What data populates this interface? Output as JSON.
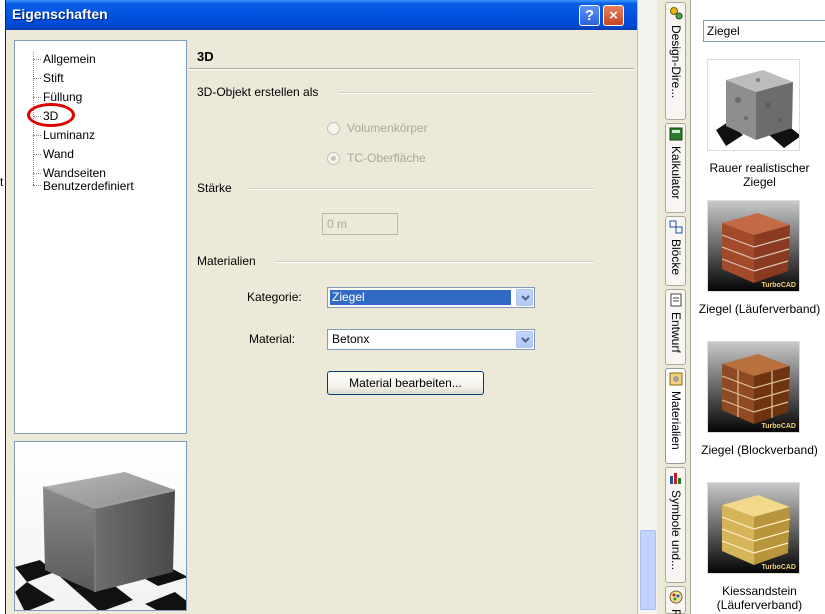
{
  "stray_text": "t",
  "dialog": {
    "title": "Eigenschaften",
    "help_label": "?",
    "close_label": "×"
  },
  "tree": {
    "items": [
      "Allgemein",
      "Stift",
      "Füllung",
      "3D",
      "Luminanz",
      "Wand",
      "Wandseiten",
      "Benutzerdefiniert"
    ],
    "selected": "3D"
  },
  "pane": {
    "title": "3D",
    "group_create": "3D-Objekt erstellen als",
    "radio_solid": "Volumenkörper",
    "radio_surface": "TC-Oberfläche",
    "group_thickness": "Stärke",
    "thickness_value": "0 m",
    "group_materials": "Materialien",
    "category_label": "Kategorie:",
    "category_value": "Ziegel",
    "material_label": "Material:",
    "material_value": "Betonx",
    "edit_button": "Material bearbeiten..."
  },
  "sidebar": {
    "search_value": "Ziegel",
    "tabs": [
      "Design-Dire...",
      "Kalkulator",
      "Blöcke",
      "Entwurf",
      "Materialien",
      "Symbole und...",
      "F"
    ],
    "active_tab": "Materialien",
    "materials": [
      {
        "label": "Rauer realistischer Ziegel",
        "badge": ""
      },
      {
        "label": "Ziegel (Läuferverband)",
        "badge": "TurboCAD"
      },
      {
        "label": "Ziegel (Blockverband)",
        "badge": "TurboCAD"
      },
      {
        "label": "Kiessandstein (Läuferverband)",
        "badge": "TurboCAD"
      }
    ]
  },
  "colors": {
    "titlebar": "#0052e0",
    "dialog_bg": "#ece9d8",
    "selection": "#316ac5",
    "annotation_oval": "#e00000"
  }
}
